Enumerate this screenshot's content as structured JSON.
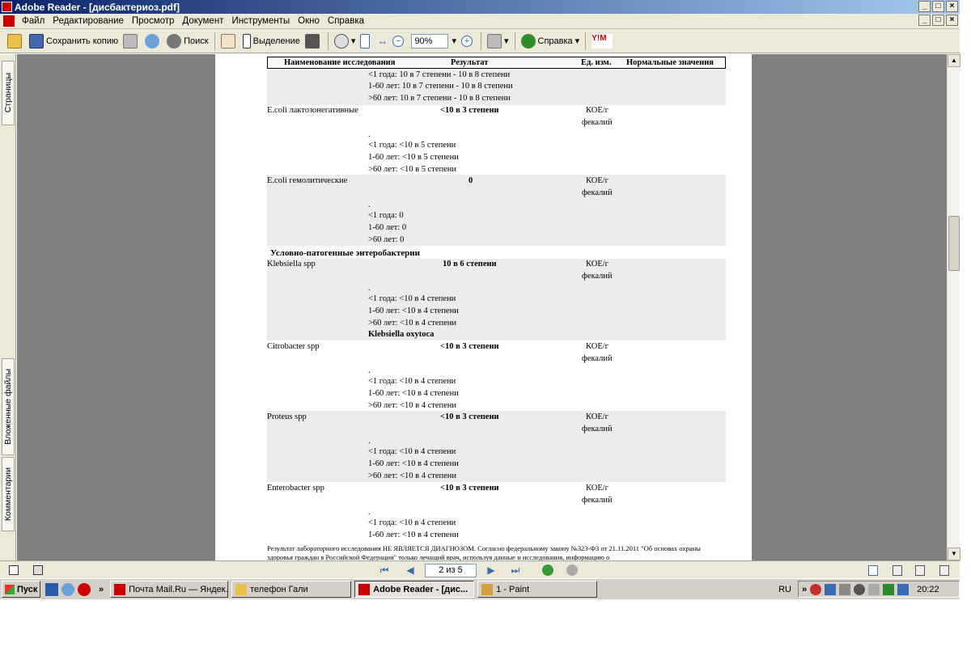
{
  "window": {
    "title": "Adobe Reader - [дисбактериоз.pdf]",
    "min": "_",
    "max": "□",
    "close": "×"
  },
  "menu": [
    "Файл",
    "Редактирование",
    "Просмотр",
    "Документ",
    "Инструменты",
    "Окно",
    "Справка"
  ],
  "toolbar": {
    "save_copy": "Сохранить копию",
    "search": "Поиск",
    "select": "Выделение",
    "zoom": "90%",
    "help": "Справка",
    "ym": "Y!M"
  },
  "sidebar": {
    "pages": "Страницы",
    "attachments": "Вложенные файлы",
    "comments": "Комментарии"
  },
  "table_header": {
    "name": "Наименование исследования",
    "result": "Результат",
    "unit": "Ед. изм.",
    "norm": "Нормальные значения"
  },
  "rows": {
    "top_norm": [
      "<1 года: 10 в 7 степени  - 10 в 8 степени",
      "1-60 лет: 10 в 7 степени  - 10 в 8 степени",
      ">60 лет: 10 в 7 степени  - 10 в 8 степени"
    ],
    "ecoli_lacto": {
      "name": "E.coli лактозонегативные",
      "result": "<10 в 3 степени",
      "unit1": "КОЕ/г",
      "unit2": "фекалий",
      "norm": [
        ".",
        "<1 года: <10 в 5 степени",
        "1-60 лет: <10 в 5 степени",
        ">60 лет: <10 в 5 степени"
      ]
    },
    "ecoli_hemo": {
      "name": "E.coli гемолитические",
      "result": "0",
      "unit1": "КОЕ/г",
      "unit2": "фекалий",
      "norm": [
        ".",
        "<1 года: 0",
        "1-60 лет: 0",
        ">60 лет: 0"
      ]
    },
    "section": "Условно-патогенные энтеробактерии",
    "klebsiella": {
      "name": "Klebsiella spp",
      "result": "10 в 6 степени",
      "unit1": "КОЕ/г",
      "unit2": "фекалий",
      "norm": [
        ".",
        "<1 года: <10 в 4 степени",
        "1-60 лет: <10 в 4 степени",
        ">60 лет: <10 в 4 степени"
      ],
      "extra": "Klebsiella oxytoca"
    },
    "citrobacter": {
      "name": "Citrobacter spp",
      "result": "<10 в 3 степени",
      "unit1": "КОЕ/г",
      "unit2": "фекалий",
      "norm": [
        ".",
        "<1 года: <10 в 4 степени",
        "1-60 лет: <10 в 4 степени",
        ">60 лет: <10 в 4 степени"
      ]
    },
    "proteus": {
      "name": "Proteus spp",
      "result": "<10 в 3 степени",
      "unit1": "КОЕ/г",
      "unit2": "фекалий",
      "norm": [
        ".",
        "<1 года: <10 в 4 степени",
        "1-60 лет: <10 в 4 степени",
        ">60 лет: <10 в 4 степени"
      ]
    },
    "enterobacter": {
      "name": "Enterobacter spp",
      "result": "<10 в 3 степени",
      "unit1": "КОЕ/г",
      "unit2": "фекалий",
      "norm": [
        ".",
        "<1 года: <10 в 4 степени",
        "1-60 лет: <10 в 4 степени"
      ]
    }
  },
  "footer_note": "Результат лабораторного исследования НЕ ЯВЛЯЕТСЯ ДИАГНОЗОМ. Согласно федеральному закону №323-ФЗ от 21.11.2011 \"Об основах охраны здоровья граждан в Российской Федерации\" только лечащий врач, используя данные и исследования, информацию о",
  "nav": {
    "page": "2 из 5"
  },
  "taskbar": {
    "start": "Пуск",
    "tasks": [
      "Почта Mail.Ru — Яндек...",
      "телефон Гали",
      "Adobe Reader - [дис...",
      "1 - Paint"
    ],
    "lang": "RU",
    "time": "20:22",
    "chevron": "»"
  }
}
